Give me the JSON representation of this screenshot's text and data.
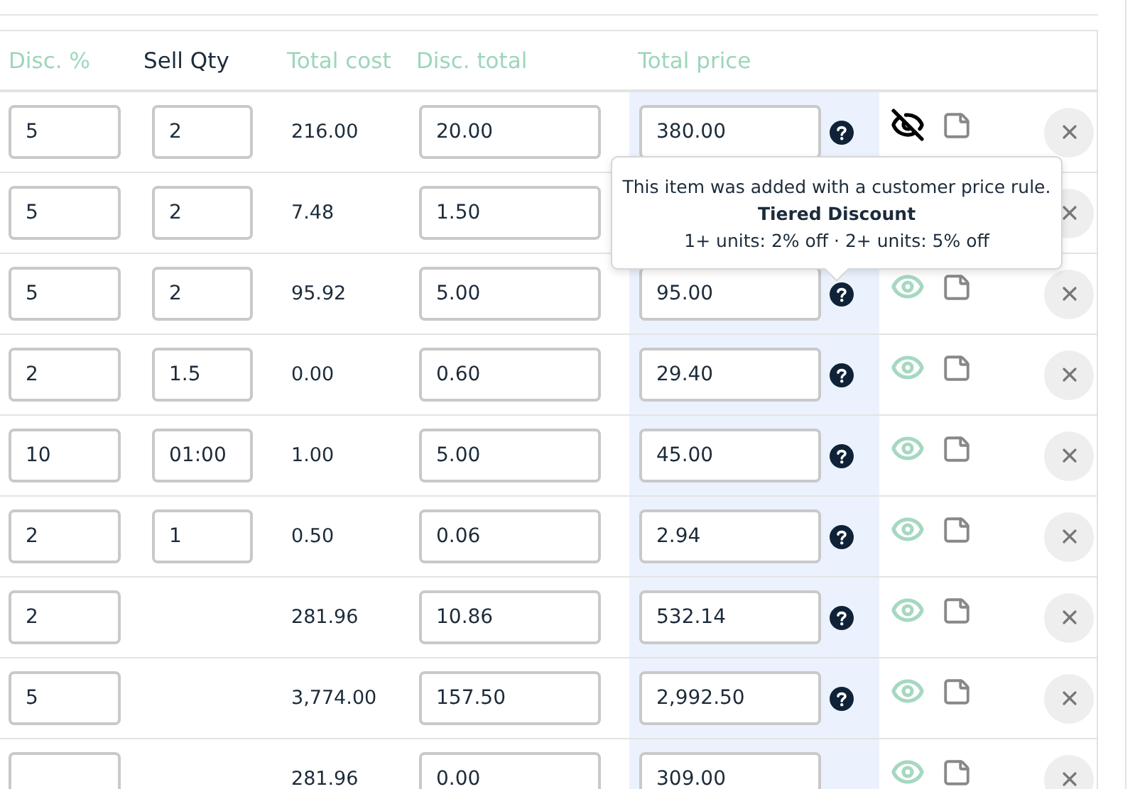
{
  "columns": [
    {
      "label": "Disc. %",
      "active": false
    },
    {
      "label": "Sell Qty",
      "active": true
    },
    {
      "label": "Total cost",
      "active": false
    },
    {
      "label": "Disc. total",
      "active": false
    },
    {
      "label": "Total price",
      "active": false
    }
  ],
  "rows": [
    {
      "disc_pct": "5",
      "has_sell_qty": true,
      "sell_qty": "2",
      "total_cost": "216.00",
      "disc_total": "20.00",
      "total_price": "380.00",
      "has_help": true,
      "visible": false
    },
    {
      "disc_pct": "5",
      "has_sell_qty": true,
      "sell_qty": "2",
      "total_cost": "7.48",
      "disc_total": "1.50",
      "covered": true
    },
    {
      "disc_pct": "5",
      "has_sell_qty": true,
      "sell_qty": "2",
      "total_cost": "95.92",
      "disc_total": "5.00",
      "total_price": "95.00",
      "has_help": true,
      "visible": true
    },
    {
      "disc_pct": "2",
      "has_sell_qty": true,
      "sell_qty": "1.5",
      "total_cost": "0.00",
      "disc_total": "0.60",
      "total_price": "29.40",
      "has_help": true,
      "visible": true
    },
    {
      "disc_pct": "10",
      "has_sell_qty": true,
      "sell_qty": "01:00",
      "total_cost": "1.00",
      "disc_total": "5.00",
      "total_price": "45.00",
      "has_help": true,
      "visible": true
    },
    {
      "disc_pct": "2",
      "has_sell_qty": true,
      "sell_qty": "1",
      "total_cost": "0.50",
      "disc_total": "0.06",
      "total_price": "2.94",
      "has_help": true,
      "visible": true
    },
    {
      "disc_pct": "2",
      "has_sell_qty": false,
      "total_cost": "281.96",
      "disc_total": "10.86",
      "total_price": "532.14",
      "has_help": true,
      "visible": true
    },
    {
      "disc_pct": "5",
      "has_sell_qty": false,
      "total_cost": "3,774.00",
      "disc_total": "157.50",
      "total_price": "2,992.50",
      "has_help": true,
      "visible": true
    },
    {
      "has_sell_qty": false,
      "total_cost": "281.96",
      "disc_total": "0.00",
      "total_price": "309.00",
      "has_help": false,
      "visible": true
    }
  ],
  "tooltip": {
    "text": "This item was added with a customer price rule.",
    "title": "Tiered Discount",
    "detail": "1+ units: 2% off · 2+ units: 5% off"
  }
}
